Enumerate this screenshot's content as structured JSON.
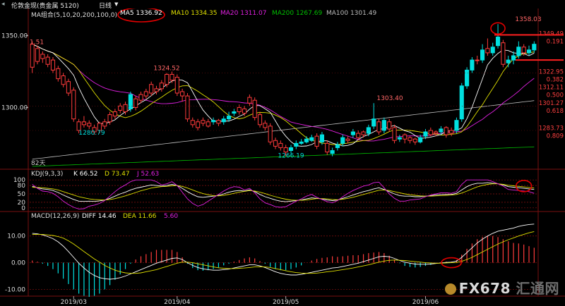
{
  "window": {
    "title": "伦敦金现(贵金属 5120)",
    "period": "日线",
    "period_arrow": "▼"
  },
  "colors": {
    "background": "#000000",
    "up": "#ff3b3b",
    "down": "#00e0e0",
    "ma5": "#ffffff",
    "ma10": "#e0e000",
    "ma20": "#e020e0",
    "ma200": "#00c000",
    "ma100": "#c0c0c0",
    "circle": "#e00000",
    "grid": "#8a1010"
  },
  "chart_data": [
    {
      "type": "candlestick",
      "legend": {
        "group": "MA组合(5,10,20,200,100,0)",
        "ma5": "MA5 1336.92",
        "ma10": "MA10 1334.35",
        "ma20": "MA20 1311.07",
        "ma200": "MA200 1267.69",
        "ma100": "MA100 1301.49"
      },
      "ylim": [
        1258,
        1362
      ],
      "yticks": [
        1300,
        1350
      ],
      "ytick_labels": [
        "1300.00",
        "1350.00"
      ],
      "x_labels": [
        "2019/03",
        "2019/04",
        "2019/05",
        "2019/06"
      ],
      "x_label_index": [
        8,
        28,
        49,
        76
      ],
      "days_label": "82天",
      "annotations": [
        "1.51",
        "1324.52",
        "1280.79",
        "1303.40",
        "1266.19",
        "1358.03"
      ],
      "right_labels": [
        "1349.49",
        "0.191",
        "1322.95",
        "0.382",
        "1312.11",
        "0.500",
        "1301.27",
        "0.618",
        "1283.73",
        "0.809"
      ],
      "ohlc": [
        [
          1328,
          1344,
          1346,
          1324
        ],
        [
          1332,
          1341,
          1343,
          1330
        ],
        [
          1334,
          1337,
          1339,
          1331
        ],
        [
          1330,
          1335,
          1337,
          1328
        ],
        [
          1326,
          1333,
          1335,
          1324
        ],
        [
          1320,
          1327,
          1329,
          1318
        ],
        [
          1316,
          1322,
          1324,
          1314
        ],
        [
          1310,
          1318,
          1320,
          1308
        ],
        [
          1292,
          1312,
          1314,
          1290
        ],
        [
          1284,
          1290,
          1292,
          1282
        ],
        [
          1288,
          1290,
          1294,
          1286
        ],
        [
          1287,
          1289,
          1291,
          1285
        ],
        [
          1283,
          1286,
          1288,
          1281
        ],
        [
          1284,
          1289,
          1290,
          1282
        ],
        [
          1287,
          1290,
          1292,
          1285
        ],
        [
          1290,
          1295,
          1297,
          1288
        ],
        [
          1294,
          1297,
          1299,
          1292
        ],
        [
          1298,
          1301,
          1303,
          1296
        ],
        [
          1297,
          1302,
          1304,
          1295
        ],
        [
          1309,
          1299,
          1311,
          1297
        ],
        [
          1300,
          1306,
          1308,
          1298
        ],
        [
          1305,
          1309,
          1311,
          1303
        ],
        [
          1308,
          1311,
          1313,
          1306
        ],
        [
          1310,
          1316,
          1318,
          1308
        ],
        [
          1311,
          1313,
          1315,
          1309
        ],
        [
          1313,
          1317,
          1319,
          1311
        ],
        [
          1316,
          1323,
          1324,
          1314
        ],
        [
          1319,
          1323,
          1325,
          1317
        ],
        [
          1310,
          1321,
          1323,
          1308
        ],
        [
          1308,
          1311,
          1313,
          1304
        ],
        [
          1292,
          1308,
          1310,
          1290
        ],
        [
          1288,
          1291,
          1293,
          1286
        ],
        [
          1286,
          1290,
          1292,
          1284
        ],
        [
          1289,
          1291,
          1293,
          1287
        ],
        [
          1287,
          1290,
          1292,
          1286
        ],
        [
          1291,
          1290,
          1293,
          1288
        ],
        [
          1289,
          1291,
          1292,
          1287
        ],
        [
          1292,
          1290,
          1294,
          1288
        ],
        [
          1294,
          1292,
          1297,
          1290
        ],
        [
          1297,
          1296,
          1299,
          1294
        ],
        [
          1297,
          1300,
          1302,
          1295
        ],
        [
          1296,
          1299,
          1301,
          1294
        ],
        [
          1303,
          1307,
          1309,
          1301
        ],
        [
          1293,
          1305,
          1307,
          1291
        ],
        [
          1288,
          1295,
          1297,
          1286
        ],
        [
          1286,
          1289,
          1291,
          1284
        ],
        [
          1276,
          1287,
          1289,
          1274
        ],
        [
          1273,
          1277,
          1279,
          1271
        ],
        [
          1272,
          1275,
          1277,
          1270
        ],
        [
          1269,
          1272,
          1274,
          1266
        ],
        [
          1272,
          1270,
          1274,
          1268
        ],
        [
          1275,
          1273,
          1277,
          1271
        ],
        [
          1276,
          1275,
          1278,
          1274
        ],
        [
          1278,
          1276,
          1280,
          1275
        ],
        [
          1279,
          1277,
          1281,
          1276
        ],
        [
          1273,
          1280,
          1282,
          1271
        ],
        [
          1281,
          1276,
          1283,
          1274
        ],
        [
          1269,
          1275,
          1277,
          1267
        ],
        [
          1270,
          1268,
          1272,
          1266
        ],
        [
          1274,
          1272,
          1276,
          1270
        ],
        [
          1279,
          1275,
          1281,
          1273
        ],
        [
          1277,
          1278,
          1280,
          1275
        ],
        [
          1283,
          1281,
          1285,
          1279
        ],
        [
          1279,
          1282,
          1284,
          1277
        ],
        [
          1281,
          1283,
          1284,
          1279
        ],
        [
          1286,
          1282,
          1288,
          1280
        ],
        [
          1292,
          1287,
          1303,
          1285
        ],
        [
          1283,
          1290,
          1292,
          1281
        ],
        [
          1291,
          1284,
          1293,
          1282
        ],
        [
          1285,
          1290,
          1292,
          1283
        ],
        [
          1277,
          1286,
          1288,
          1275
        ],
        [
          1279,
          1278,
          1281,
          1276
        ],
        [
          1278,
          1281,
          1282,
          1275
        ],
        [
          1277,
          1279,
          1280,
          1275
        ],
        [
          1276,
          1278,
          1279,
          1274
        ],
        [
          1279,
          1276,
          1281,
          1275
        ],
        [
          1283,
          1280,
          1285,
          1278
        ],
        [
          1281,
          1284,
          1286,
          1280
        ],
        [
          1282,
          1283,
          1284,
          1280
        ],
        [
          1285,
          1283,
          1287,
          1281
        ],
        [
          1281,
          1286,
          1287,
          1279
        ],
        [
          1282,
          1284,
          1286,
          1280
        ],
        [
          1291,
          1284,
          1293,
          1282
        ],
        [
          1315,
          1292,
          1317,
          1290
        ],
        [
          1326,
          1315,
          1328,
          1313
        ],
        [
          1333,
          1326,
          1335,
          1324
        ],
        [
          1333,
          1333,
          1336,
          1330
        ],
        [
          1340,
          1333,
          1344,
          1331
        ],
        [
          1338,
          1341,
          1348,
          1336
        ],
        [
          1342,
          1338,
          1345,
          1336
        ],
        [
          1349,
          1343,
          1358,
          1341
        ],
        [
          1330,
          1345,
          1347,
          1328
        ],
        [
          1333,
          1331,
          1336,
          1328
        ],
        [
          1336,
          1333,
          1339,
          1330
        ],
        [
          1342,
          1336,
          1346,
          1334
        ],
        [
          1338,
          1342,
          1344,
          1336
        ],
        [
          1340,
          1338,
          1343,
          1336
        ],
        [
          1344,
          1340,
          1346,
          1338
        ]
      ]
    },
    {
      "type": "line",
      "legend": {
        "name": "KDJ(9,3,3)",
        "k": "K 66.52",
        "d": "D 73.47",
        "j": "J 52.63"
      },
      "ylim": [
        -8,
        108
      ],
      "yticks": [
        0,
        20,
        50,
        80,
        100
      ],
      "ytick_labels": [
        "0",
        "20",
        "50",
        "80",
        "100"
      ],
      "series": [
        {
          "name": "K",
          "values": [
            77,
            72,
            68,
            66,
            62,
            55,
            46,
            38,
            30,
            24,
            23,
            24,
            23,
            25,
            28,
            34,
            42,
            50,
            56,
            64,
            70,
            74,
            78,
            82,
            80,
            78,
            80,
            84,
            80,
            70,
            58,
            48,
            40,
            38,
            40,
            42,
            45,
            50,
            56,
            60,
            62,
            60,
            64,
            58,
            48,
            40,
            34,
            28,
            24,
            22,
            24,
            26,
            28,
            32,
            36,
            34,
            32,
            28,
            26,
            28,
            34,
            40,
            46,
            52,
            58,
            62,
            68,
            72,
            66,
            58,
            50,
            44,
            42,
            42,
            40,
            40,
            42,
            44,
            46,
            48,
            48,
            48,
            52,
            64,
            76,
            84,
            88,
            88,
            90,
            88,
            86,
            82,
            76,
            74,
            72,
            70,
            68,
            66
          ]
        },
        {
          "name": "D",
          "values": [
            74,
            73,
            72,
            70,
            68,
            64,
            58,
            52,
            46,
            40,
            36,
            32,
            30,
            29,
            28,
            30,
            33,
            38,
            43,
            49,
            55,
            61,
            66,
            71,
            74,
            76,
            77,
            79,
            80,
            77,
            71,
            64,
            57,
            51,
            47,
            44,
            43,
            45,
            48,
            52,
            56,
            59,
            62,
            60,
            56,
            51,
            45,
            40,
            35,
            31,
            28,
            27,
            27,
            28,
            31,
            33,
            33,
            32,
            30,
            29,
            31,
            34,
            38,
            43,
            48,
            53,
            58,
            63,
            64,
            62,
            58,
            54,
            50,
            47,
            45,
            43,
            42,
            42,
            43,
            44,
            45,
            46,
            48,
            53,
            60,
            68,
            75,
            80,
            84,
            86,
            86,
            84,
            81,
            79,
            77,
            75,
            73,
            71
          ]
        },
        {
          "name": "J",
          "values": [
            84,
            70,
            60,
            58,
            52,
            40,
            24,
            12,
            2,
            -4,
            -3,
            6,
            10,
            16,
            26,
            42,
            58,
            72,
            82,
            94,
            100,
            100,
            100,
            100,
            94,
            82,
            86,
            94,
            80,
            56,
            32,
            16,
            6,
            12,
            24,
            36,
            48,
            60,
            70,
            76,
            74,
            64,
            70,
            54,
            32,
            18,
            12,
            4,
            2,
            4,
            14,
            24,
            32,
            42,
            48,
            38,
            30,
            22,
            18,
            26,
            40,
            52,
            62,
            70,
            78,
            82,
            90,
            92,
            72,
            50,
            34,
            24,
            24,
            28,
            30,
            32,
            40,
            46,
            50,
            54,
            54,
            52,
            58,
            84,
            100,
            100,
            100,
            100,
            100,
            94,
            86,
            78,
            66,
            64,
            62,
            60,
            58,
            52
          ]
        }
      ]
    },
    {
      "type": "bar+line",
      "legend": {
        "name": "MACD(12,26,9)",
        "diff": "DIFF 14.46",
        "dea": "DEA 11.66",
        "macd": "5.60"
      },
      "ylim": [
        -12,
        16
      ],
      "yticks": [
        -10,
        0,
        10
      ],
      "ytick_labels": [
        "-10.00",
        "0.00",
        "10.00"
      ],
      "series": [
        {
          "name": "DIFF",
          "values": [
            11,
            10.8,
            10.4,
            9.8,
            9,
            7.8,
            6.2,
            4.2,
            2,
            -0.2,
            -2,
            -3.6,
            -4.8,
            -5.6,
            -6,
            -6.2,
            -6,
            -5.6,
            -5,
            -4.2,
            -3.4,
            -2.6,
            -1.8,
            -1,
            -0.2,
            0.4,
            1,
            1.6,
            1.8,
            1.2,
            0,
            -1,
            -1.8,
            -2.3,
            -2.6,
            -2.8,
            -2.8,
            -2.6,
            -2.4,
            -2,
            -1.6,
            -1.2,
            -0.8,
            -0.8,
            -1.2,
            -1.8,
            -2.6,
            -3.4,
            -4,
            -4.4,
            -4.6,
            -4.6,
            -4.4,
            -4,
            -3.6,
            -3.2,
            -2.8,
            -2.4,
            -2,
            -1.8,
            -1.4,
            -1,
            -0.6,
            -0.2,
            0.4,
            1,
            1.6,
            2.2,
            2.4,
            2.2,
            1.6,
            0.8,
            0.2,
            -0.2,
            -0.5,
            -0.6,
            -0.6,
            -0.5,
            -0.3,
            -0.1,
            0.1,
            0.2,
            0.6,
            2,
            3.8,
            5.6,
            7.4,
            8.8,
            10,
            11,
            11.8,
            12.2,
            12.6,
            13,
            13.6,
            14,
            14.3,
            14.46
          ]
        },
        {
          "name": "DEA",
          "values": [
            10.6,
            10.6,
            10.6,
            10.4,
            10.2,
            9.8,
            9.2,
            8.2,
            7,
            5.6,
            4.2,
            2.8,
            1.4,
            0.2,
            -1,
            -2,
            -2.8,
            -3.4,
            -3.8,
            -4,
            -4,
            -3.8,
            -3.4,
            -3,
            -2.6,
            -2,
            -1.4,
            -0.8,
            -0.2,
            0.2,
            0.2,
            0,
            -0.4,
            -0.8,
            -1.2,
            -1.6,
            -1.9,
            -2.1,
            -2.2,
            -2.2,
            -2.1,
            -2,
            -1.8,
            -1.6,
            -1.5,
            -1.6,
            -1.8,
            -2.2,
            -2.6,
            -3,
            -3.4,
            -3.7,
            -3.9,
            -4,
            -4,
            -3.9,
            -3.7,
            -3.4,
            -3.2,
            -2.9,
            -2.6,
            -2.3,
            -2,
            -1.6,
            -1.2,
            -0.8,
            -0.3,
            0.2,
            0.6,
            0.9,
            1,
            0.9,
            0.8,
            0.6,
            0.4,
            0.2,
            0,
            -0.1,
            -0.2,
            -0.2,
            -0.1,
            0,
            0.1,
            0.5,
            1.2,
            2,
            3,
            4,
            5,
            6,
            7,
            7.8,
            8.6,
            9.3,
            10,
            10.6,
            11.2,
            11.66
          ]
        }
      ]
    }
  ],
  "watermark": {
    "brand": "FX678",
    "cn": "汇通网"
  }
}
